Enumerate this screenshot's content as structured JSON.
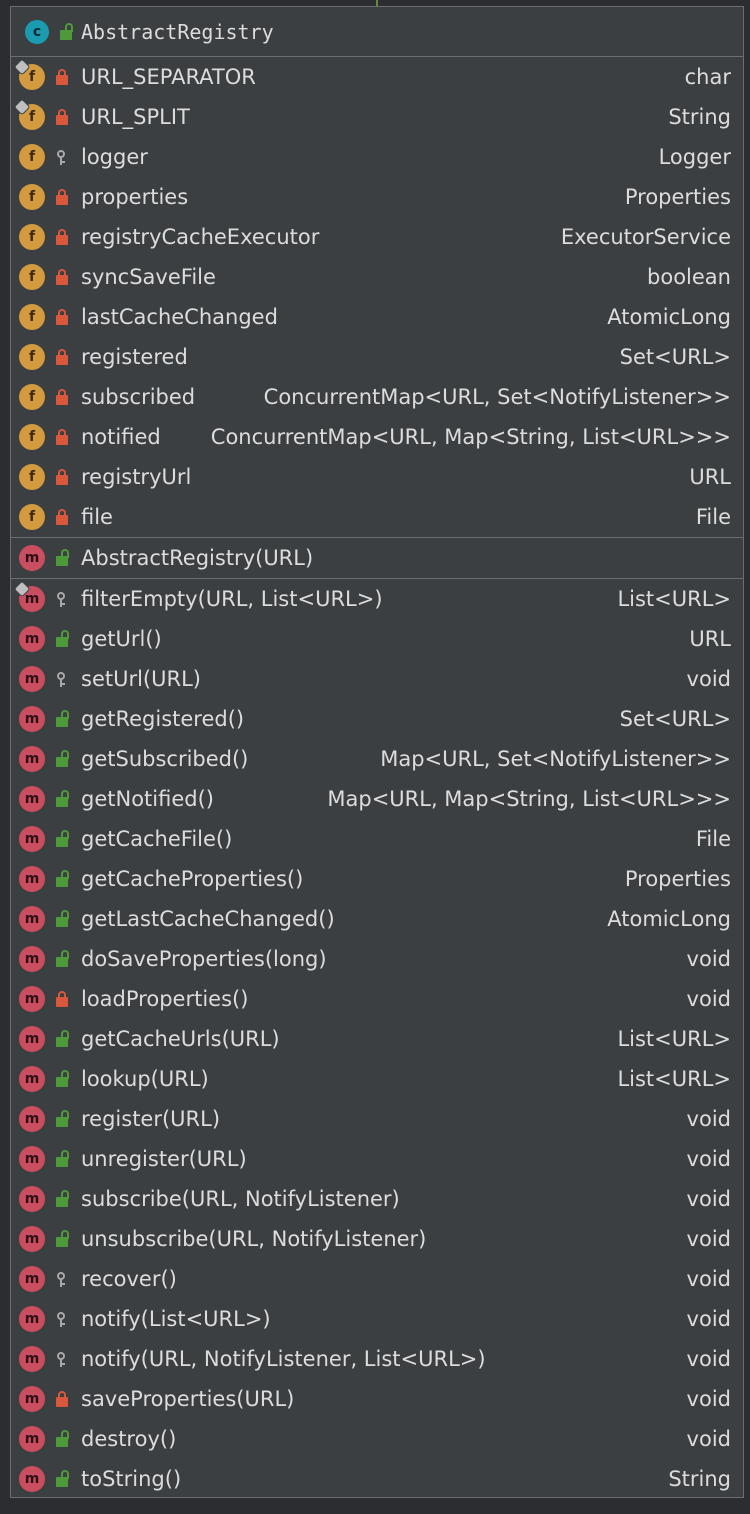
{
  "class": {
    "name": "AbstractRegistry",
    "kind": "class",
    "icon_letter": "c",
    "visibility": "public"
  },
  "fields": [
    {
      "name": "URL_SEPARATOR",
      "type": "char",
      "visibility": "private",
      "static": true
    },
    {
      "name": "URL_SPLIT",
      "type": "String",
      "visibility": "private",
      "static": true
    },
    {
      "name": "logger",
      "type": "Logger",
      "visibility": "package",
      "static": false
    },
    {
      "name": "properties",
      "type": "Properties",
      "visibility": "private",
      "static": false
    },
    {
      "name": "registryCacheExecutor",
      "type": "ExecutorService",
      "visibility": "private",
      "static": false
    },
    {
      "name": "syncSaveFile",
      "type": "boolean",
      "visibility": "private",
      "static": false
    },
    {
      "name": "lastCacheChanged",
      "type": "AtomicLong",
      "visibility": "private",
      "static": false
    },
    {
      "name": "registered",
      "type": "Set<URL>",
      "visibility": "private",
      "static": false
    },
    {
      "name": "subscribed",
      "type": "ConcurrentMap<URL, Set<NotifyListener>>",
      "visibility": "private",
      "static": false
    },
    {
      "name": "notified",
      "type": "ConcurrentMap<URL, Map<String, List<URL>>>",
      "visibility": "private",
      "static": false
    },
    {
      "name": "registryUrl",
      "type": "URL",
      "visibility": "private",
      "static": false
    },
    {
      "name": "file",
      "type": "File",
      "visibility": "private",
      "static": false
    }
  ],
  "constructors": [
    {
      "name": "AbstractRegistry(URL)",
      "type": "",
      "visibility": "public",
      "static": false
    }
  ],
  "methods": [
    {
      "name": "filterEmpty(URL, List<URL>)",
      "type": "List<URL>",
      "visibility": "package",
      "static": true
    },
    {
      "name": "getUrl()",
      "type": "URL",
      "visibility": "public",
      "static": false
    },
    {
      "name": "setUrl(URL)",
      "type": "void",
      "visibility": "package",
      "static": false
    },
    {
      "name": "getRegistered()",
      "type": "Set<URL>",
      "visibility": "public",
      "static": false
    },
    {
      "name": "getSubscribed()",
      "type": "Map<URL, Set<NotifyListener>>",
      "visibility": "public",
      "static": false
    },
    {
      "name": "getNotified()",
      "type": "Map<URL, Map<String, List<URL>>>",
      "visibility": "public",
      "static": false
    },
    {
      "name": "getCacheFile()",
      "type": "File",
      "visibility": "public",
      "static": false
    },
    {
      "name": "getCacheProperties()",
      "type": "Properties",
      "visibility": "public",
      "static": false
    },
    {
      "name": "getLastCacheChanged()",
      "type": "AtomicLong",
      "visibility": "public",
      "static": false
    },
    {
      "name": "doSaveProperties(long)",
      "type": "void",
      "visibility": "public",
      "static": false
    },
    {
      "name": "loadProperties()",
      "type": "void",
      "visibility": "private",
      "static": false
    },
    {
      "name": "getCacheUrls(URL)",
      "type": "List<URL>",
      "visibility": "public",
      "static": false
    },
    {
      "name": "lookup(URL)",
      "type": "List<URL>",
      "visibility": "public",
      "static": false
    },
    {
      "name": "register(URL)",
      "type": "void",
      "visibility": "public",
      "static": false
    },
    {
      "name": "unregister(URL)",
      "type": "void",
      "visibility": "public",
      "static": false
    },
    {
      "name": "subscribe(URL, NotifyListener)",
      "type": "void",
      "visibility": "public",
      "static": false
    },
    {
      "name": "unsubscribe(URL, NotifyListener)",
      "type": "void",
      "visibility": "public",
      "static": false
    },
    {
      "name": "recover()",
      "type": "void",
      "visibility": "package",
      "static": false
    },
    {
      "name": "notify(List<URL>)",
      "type": "void",
      "visibility": "package",
      "static": false
    },
    {
      "name": "notify(URL, NotifyListener, List<URL>)",
      "type": "void",
      "visibility": "package",
      "static": false
    },
    {
      "name": "saveProperties(URL)",
      "type": "void",
      "visibility": "private",
      "static": false
    },
    {
      "name": "destroy()",
      "type": "void",
      "visibility": "public",
      "static": false
    },
    {
      "name": "toString()",
      "type": "String",
      "visibility": "public",
      "static": false
    }
  ],
  "icons": {
    "field": "f",
    "method": "m"
  },
  "colors": {
    "background": "#2b2d30",
    "card": "#3c3f41",
    "field_icon": "#d39a3f",
    "method_icon": "#c94e60",
    "class_icon": "#1b9bb0",
    "private_lock": "#d9573c",
    "public_lock": "#4e9a3a",
    "package_key": "#a8a8a8",
    "text": "#dcdcdc"
  }
}
